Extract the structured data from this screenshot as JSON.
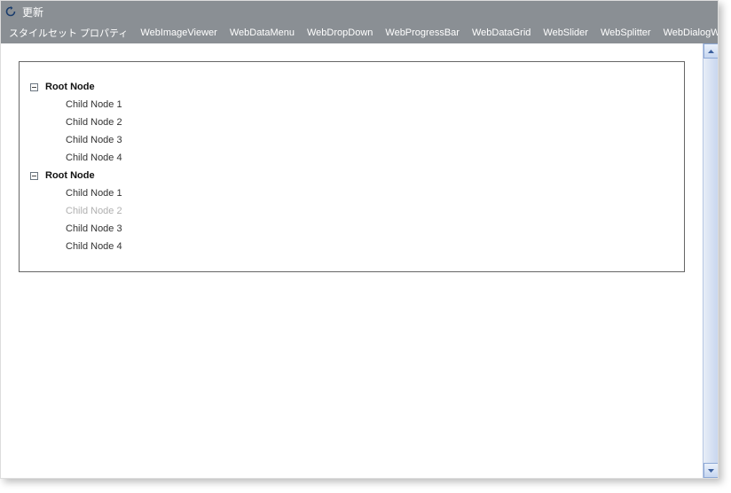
{
  "title": "更新",
  "menu": {
    "items": [
      "スタイルセット プロパティ",
      "WebImageViewer",
      "WebDataMenu",
      "WebDropDown",
      "WebProgressBar",
      "WebDataGrid",
      "WebSlider",
      "WebSplitter",
      "WebDialogWindow"
    ]
  },
  "tree": {
    "roots": [
      {
        "label": "Root Node",
        "children": [
          {
            "label": "Child Node 1",
            "disabled": false
          },
          {
            "label": "Child Node 2",
            "disabled": false
          },
          {
            "label": "Child Node 3",
            "disabled": false
          },
          {
            "label": "Child Node 4",
            "disabled": false
          }
        ]
      },
      {
        "label": "Root Node",
        "children": [
          {
            "label": "Child Node 1",
            "disabled": false
          },
          {
            "label": "Child Node 2",
            "disabled": true
          },
          {
            "label": "Child Node 3",
            "disabled": false
          },
          {
            "label": "Child Node 4",
            "disabled": false
          }
        ]
      }
    ]
  }
}
